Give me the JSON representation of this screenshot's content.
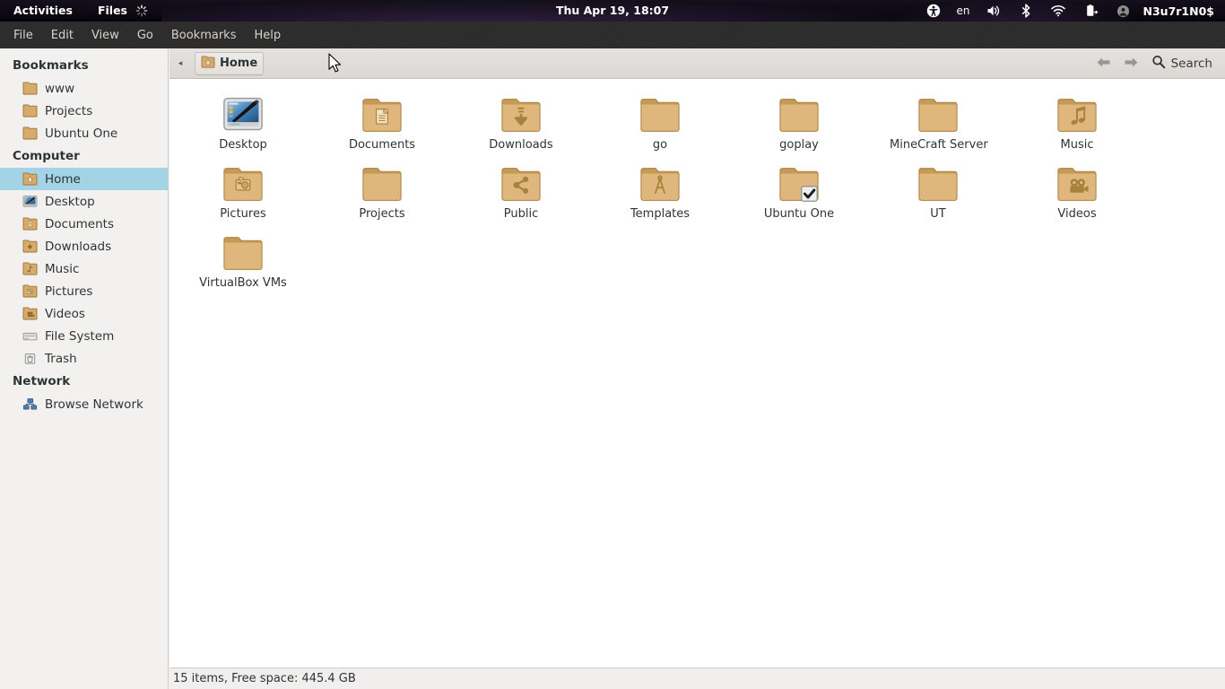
{
  "topbar": {
    "activities": "Activities",
    "app_name": "Files",
    "spinner": "loading-spinner",
    "clock": "Thu Apr 19, 18:07",
    "language": "en",
    "user": "N3u7r1N0$",
    "icons": [
      "accessibility-icon",
      "volume-icon",
      "bluetooth-icon",
      "wifi-icon",
      "battery-icon",
      "user-status-icon"
    ]
  },
  "menubar": {
    "items": [
      "File",
      "Edit",
      "View",
      "Go",
      "Bookmarks",
      "Help"
    ]
  },
  "sidebar": {
    "sections": [
      {
        "title": "Bookmarks",
        "items": [
          {
            "label": "www",
            "icon": "folder-icon",
            "selected": false
          },
          {
            "label": "Projects",
            "icon": "folder-icon",
            "selected": false
          },
          {
            "label": "Ubuntu One",
            "icon": "folder-icon",
            "selected": false
          }
        ]
      },
      {
        "title": "Computer",
        "items": [
          {
            "label": "Home",
            "icon": "home-folder-icon",
            "selected": true
          },
          {
            "label": "Desktop",
            "icon": "desktop-icon",
            "selected": false
          },
          {
            "label": "Documents",
            "icon": "documents-folder-icon",
            "selected": false
          },
          {
            "label": "Downloads",
            "icon": "downloads-folder-icon",
            "selected": false
          },
          {
            "label": "Music",
            "icon": "music-folder-icon",
            "selected": false
          },
          {
            "label": "Pictures",
            "icon": "pictures-folder-icon",
            "selected": false
          },
          {
            "label": "Videos",
            "icon": "videos-folder-icon",
            "selected": false
          },
          {
            "label": "File System",
            "icon": "drive-icon",
            "selected": false
          },
          {
            "label": "Trash",
            "icon": "trash-icon",
            "selected": false
          }
        ]
      },
      {
        "title": "Network",
        "items": [
          {
            "label": "Browse Network",
            "icon": "network-icon",
            "selected": false
          }
        ]
      }
    ]
  },
  "toolbar": {
    "path_back_arrow": "◂",
    "breadcrumb": "Home",
    "breadcrumb_icon": "home-folder-icon",
    "back_arrow": "⬅",
    "forward_arrow": "➡",
    "search_label": "Search",
    "search_icon": "search-icon"
  },
  "files": [
    {
      "name": "Desktop",
      "type": "desktop"
    },
    {
      "name": "Documents",
      "type": "documents"
    },
    {
      "name": "Downloads",
      "type": "downloads"
    },
    {
      "name": "go",
      "type": "plain"
    },
    {
      "name": "goplay",
      "type": "plain"
    },
    {
      "name": "MineCraft Server",
      "type": "plain"
    },
    {
      "name": "Music",
      "type": "music"
    },
    {
      "name": "Pictures",
      "type": "pictures"
    },
    {
      "name": "Projects",
      "type": "plain"
    },
    {
      "name": "Public",
      "type": "public"
    },
    {
      "name": "Templates",
      "type": "templates"
    },
    {
      "name": "Ubuntu One",
      "type": "ubuntuone"
    },
    {
      "name": "UT",
      "type": "plain"
    },
    {
      "name": "Videos",
      "type": "videos"
    },
    {
      "name": "VirtualBox VMs",
      "type": "plain"
    }
  ],
  "statusbar": {
    "text": "15 items, Free space: 445.4 GB"
  },
  "colors": {
    "selection": "#a3d3e4",
    "folder": "#d9ad6e",
    "topbar": "#0d0a13",
    "menubar": "#2b2b2b",
    "pane": "#ffffff"
  }
}
